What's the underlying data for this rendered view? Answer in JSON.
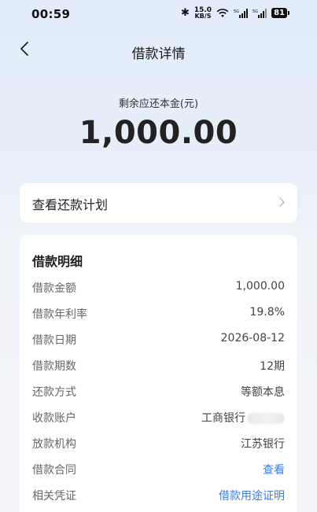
{
  "status_bar": {
    "time": "00:59",
    "net_speed_value": "15.0",
    "net_speed_unit": "KB/S",
    "signal1_label": "5G",
    "signal2_label": "5G",
    "battery": "81"
  },
  "nav": {
    "title": "借款详情"
  },
  "summary": {
    "label": "剩余应还本金(元)",
    "amount": "1,000.00"
  },
  "plan": {
    "label": "查看还款计划"
  },
  "details": {
    "title": "借款明细",
    "rows": [
      {
        "key": "借款金额",
        "value": "1,000.00"
      },
      {
        "key": "借款年利率",
        "value": "19.8%"
      },
      {
        "key": "借款日期",
        "value": "2026-08-12"
      },
      {
        "key": "借款期数",
        "value": "12期"
      },
      {
        "key": "还款方式",
        "value": "等额本息"
      },
      {
        "key": "收款账户",
        "value": "工商银行"
      },
      {
        "key": "放款机构",
        "value": "江苏银行"
      },
      {
        "key": "借款合同",
        "value": "查看"
      },
      {
        "key": "相关凭证",
        "value": "借款用途证明"
      }
    ]
  },
  "colors": {
    "link": "#3d7ce0",
    "background_top": "#e2ecfa"
  }
}
